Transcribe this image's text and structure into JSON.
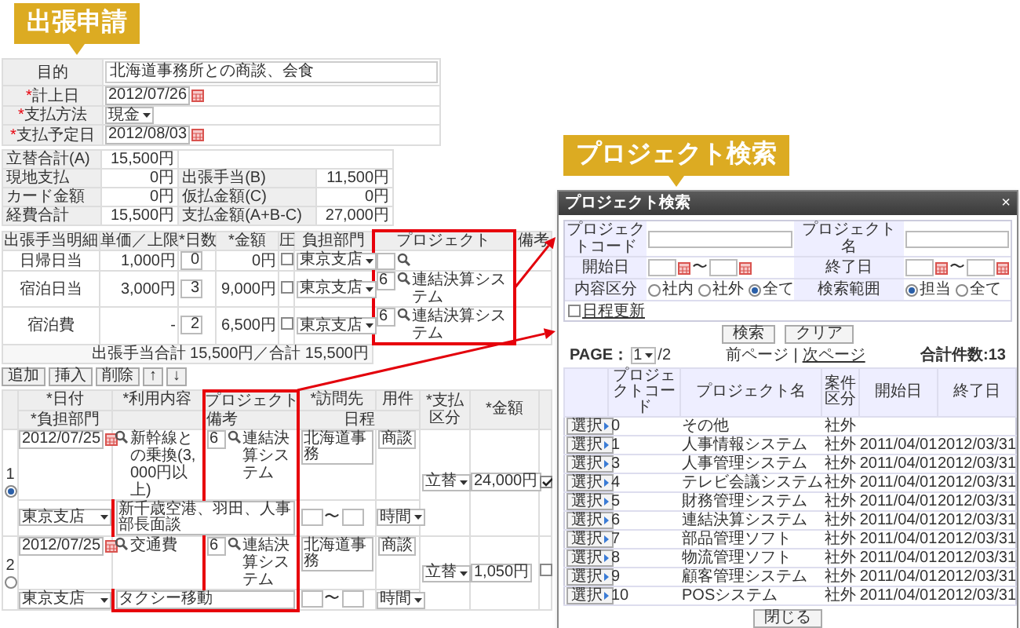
{
  "callouts": [
    {
      "text": "出張申請"
    },
    {
      "text": "プロジェクト検索"
    }
  ],
  "application": {
    "purpose": {
      "label": "目的",
      "value": "北海道事務所との商談、会食"
    },
    "fields": [
      {
        "mark": "*",
        "label": "計上日",
        "kind": "date",
        "value": "2012/07/26"
      },
      {
        "mark": "*",
        "label": "支払方法",
        "kind": "select",
        "value": "現金"
      },
      {
        "mark": "*",
        "label": "支払予定日",
        "kind": "date",
        "value": "2012/08/03"
      }
    ],
    "summary": [
      {
        "label": "立替合計(A)",
        "value": "15,500円"
      },
      {
        "label": "現地支払",
        "value": "0円"
      },
      {
        "label": "出張手当(B)",
        "value": "11,500円"
      },
      {
        "label": "カード金額",
        "value": "0円"
      },
      {
        "label": "仮払金額(C)",
        "value": "0円"
      },
      {
        "label": "経費合計",
        "value": "15,500円"
      },
      {
        "label": "支払金額(A+B-C)",
        "value": "27,000円"
      }
    ],
    "allowance": {
      "columns": [
        "出張手当明細",
        "単価／上限",
        "*日数",
        "*金額",
        "圧",
        "負担部門",
        "プロジェクト",
        "備考"
      ],
      "rows": [
        {
          "item": "日帰日当",
          "unit": "1,000円",
          "days": "0",
          "amount": "0円",
          "checked": false,
          "department": "東京支店"
        },
        {
          "item": "宿泊日当",
          "unit": "3,000円",
          "days": "3",
          "amount": "9,000円",
          "checked": false,
          "department": "東京支店",
          "project_code": "6",
          "project_name": "連結決算システム"
        },
        {
          "item": "宿泊費",
          "unit": "-",
          "days": "2",
          "amount": "6,500円",
          "checked": false,
          "department": "東京支店",
          "project_code": "6",
          "project_name": "連結決算システム"
        }
      ],
      "total": "出張手当合計 15,500円／合計 15,500円"
    },
    "row_buttons": [
      "追加",
      "挿入",
      "削除",
      "↑",
      "↓"
    ],
    "expenses": {
      "header_top": [
        "*日付",
        "*利用内容",
        "プロジェクト",
        "*訪問先",
        "用件",
        "*支払区分",
        "*金額"
      ],
      "header_bottom": [
        "*負担部門",
        "備考",
        "日程"
      ],
      "rows": [
        {
          "number": "1",
          "selected": true,
          "date": "2012/07/25",
          "usage": "新幹線との乗換(3,000円以上)",
          "project_code": "6",
          "project_name": "連結決算システム",
          "destination": "北海道事務",
          "purpose": "商談",
          "payment": "立替",
          "amount": "24,000円",
          "checked": true,
          "department": "東京支店",
          "note": "新千歳空港、羽田、人事部長面談",
          "range": "〜",
          "time_unit": "時間"
        },
        {
          "number": "2",
          "selected": false,
          "date": "2012/07/25",
          "usage": "交通費",
          "project_code": "6",
          "project_name": "連結決算システム",
          "destination": "北海道事務",
          "purpose": "商談",
          "payment": "立替",
          "amount": "1,050円",
          "checked": false,
          "department": "東京支店",
          "note": "タクシー移動",
          "range": "〜",
          "time_unit": "時間"
        }
      ]
    }
  },
  "dialog": {
    "title": "プロジェクト検索",
    "close": "×",
    "search": {
      "code_label": "プロジェクトコード",
      "name_label": "プロジェクト名",
      "start_label": "開始日",
      "end_label": "終了日",
      "range": "〜",
      "type_label": "内容区分",
      "types": [
        {
          "label": "社内",
          "selected": false
        },
        {
          "label": "社外",
          "selected": false
        },
        {
          "label": "全て",
          "selected": true
        }
      ],
      "scope_label": "検索範囲",
      "scopes": [
        {
          "label": "担当",
          "selected": true
        },
        {
          "label": "全て",
          "selected": false
        }
      ],
      "option": {
        "label": "日程更新",
        "checked": false
      }
    },
    "buttons": [
      "検索",
      "クリア"
    ],
    "pager": {
      "label": "PAGE：",
      "page": "1",
      "pages": "/2",
      "prev": "前ページ",
      "separator": "|",
      "next": "次ページ",
      "total": "合計件数:13"
    },
    "columns": [
      "プロジェクトコード",
      "プロジェクト名",
      "案件区分",
      "開始日",
      "終了日"
    ],
    "rows": [
      {
        "button": "選択",
        "code": "0",
        "name": "その他",
        "type": "社外"
      },
      {
        "button": "選択",
        "code": "1",
        "name": "人事情報システム",
        "type": "社外",
        "start": "2011/04/01",
        "end": "2012/03/31"
      },
      {
        "button": "選択",
        "code": "3",
        "name": "人事管理システム",
        "type": "社外",
        "start": "2011/04/01",
        "end": "2012/03/31"
      },
      {
        "button": "選択",
        "code": "4",
        "name": "テレビ会議システム",
        "type": "社外",
        "start": "2011/04/01",
        "end": "2012/03/31"
      },
      {
        "button": "選択",
        "code": "5",
        "name": "財務管理システム",
        "type": "社外",
        "start": "2011/04/01",
        "end": "2012/03/31"
      },
      {
        "button": "選択",
        "code": "6",
        "name": "連結決算システム",
        "type": "社外",
        "start": "2011/04/01",
        "end": "2012/03/31"
      },
      {
        "button": "選択",
        "code": "7",
        "name": "部品管理ソフト",
        "type": "社外",
        "start": "2011/04/01",
        "end": "2012/03/31"
      },
      {
        "button": "選択",
        "code": "8",
        "name": "物流管理ソフト",
        "type": "社外",
        "start": "2011/04/01",
        "end": "2012/03/31"
      },
      {
        "button": "選択",
        "code": "9",
        "name": "顧客管理システム",
        "type": "社外",
        "start": "2011/04/01",
        "end": "2012/03/31"
      },
      {
        "button": "選択",
        "code": "10",
        "name": "POSシステム",
        "type": "社外",
        "start": "2011/04/01",
        "end": "2012/03/31"
      }
    ],
    "close_button": "閉じる"
  }
}
